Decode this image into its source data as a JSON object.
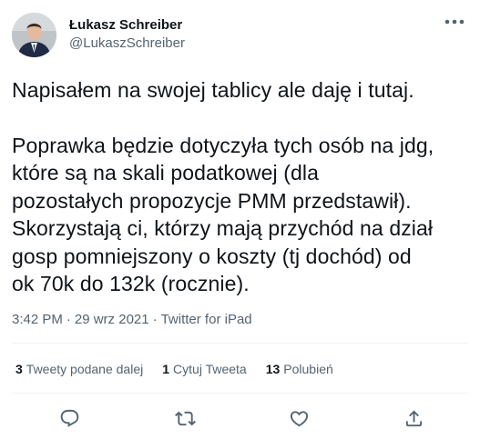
{
  "author": {
    "display_name": "Łukasz Schreiber",
    "handle": "@LukaszSchreiber"
  },
  "tweet": {
    "paragraph1": "Napisałem na swojej tablicy ale daję i tutaj.",
    "paragraph2_lines": [
      "Poprawka będzie dotyczyła tych osób na jdg,",
      "które są na skali podatkowej (dla",
      "pozostałych propozycje PMM przedstawił).",
      "Skorzystają ci, którzy mają przychód na dział",
      "gosp pomniejszony o koszty (tj dochód) od",
      "ok 70k do 132k (rocznie)."
    ]
  },
  "meta": {
    "time": "3:42 PM",
    "separator1": "·",
    "date": "29 wrz 2021",
    "separator2": "·",
    "source": "Twitter for iPad"
  },
  "stats": {
    "retweets_count": "3",
    "retweets_label": "Tweety podane dalej",
    "quotes_count": "1",
    "quotes_label": "Cytuj Tweeta",
    "likes_count": "13",
    "likes_label": "Polubień"
  },
  "icons": {
    "more": "more-horizontal-icon",
    "reply": "reply-icon",
    "retweet": "retweet-icon",
    "like": "heart-icon",
    "share": "share-icon"
  },
  "colors": {
    "text_primary": "#0f1419",
    "text_secondary": "#536471",
    "divider": "#eff3f4"
  }
}
